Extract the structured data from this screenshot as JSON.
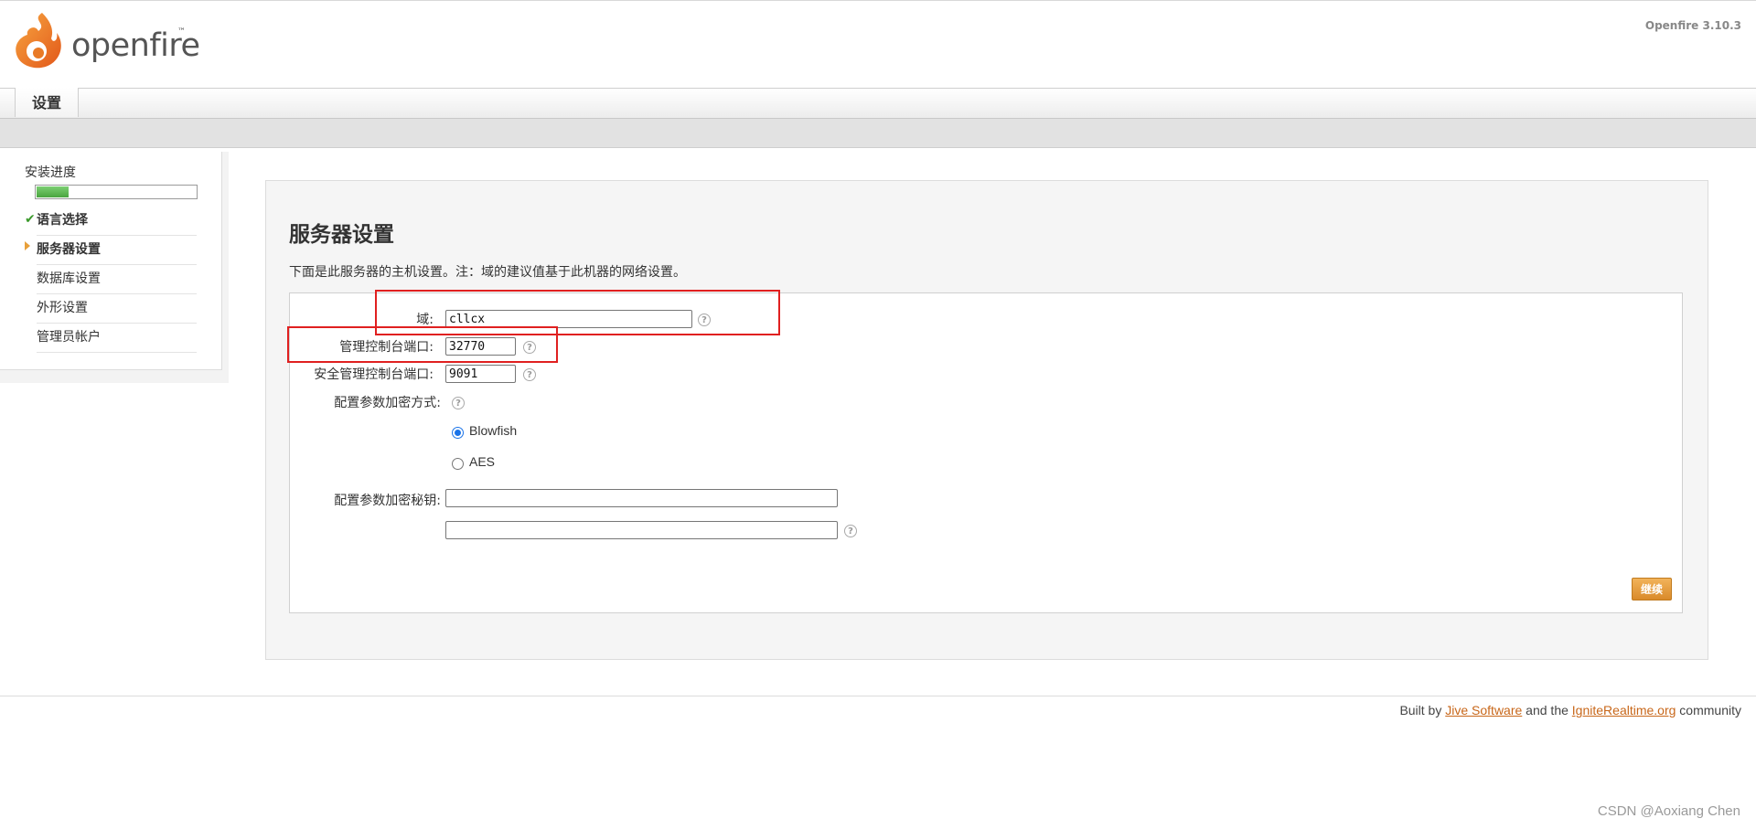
{
  "header": {
    "logo_text": "openfire",
    "logo_tm": "™",
    "version": "Openfire 3.10.3"
  },
  "tabs": [
    {
      "label": "设置",
      "active": true
    }
  ],
  "sidebar": {
    "progress_label": "安装进度",
    "progress": 0.2,
    "items": [
      {
        "label": "语言选择",
        "state": "done"
      },
      {
        "label": "服务器设置",
        "state": "current"
      },
      {
        "label": "数据库设置",
        "state": "pending"
      },
      {
        "label": "外形设置",
        "state": "pending"
      },
      {
        "label": "管理员帐户",
        "state": "pending"
      }
    ]
  },
  "main": {
    "title": "服务器设置",
    "description": "下面是此服务器的主机设置。注：域的建议值基于此机器的网络设置。",
    "fields": {
      "domain": {
        "label": "域:",
        "value": "cllcx"
      },
      "admin_port": {
        "label": "管理控制台端口:",
        "value": "32770"
      },
      "secure_admin_port": {
        "label": "安全管理控制台端口:",
        "value": "9091"
      },
      "encryption": {
        "label": "配置参数加密方式:",
        "options": [
          {
            "label": "Blowfish",
            "selected": true
          },
          {
            "label": "AES",
            "selected": false
          }
        ]
      },
      "encryption_key": {
        "label": "配置参数加密秘钥:",
        "value": "",
        "confirm_value": ""
      }
    },
    "help_glyph": "?",
    "continue_label": "继续"
  },
  "footer": {
    "prefix": "Built by ",
    "link1": "Jive Software",
    "middle": " and the ",
    "link2": "IgniteRealtime.org",
    "suffix": " community"
  },
  "watermark": "CSDN @Aoxiang Chen",
  "colors": {
    "accent_orange": "#e8862a",
    "progress_green": "#4aa53f",
    "annotation_red": "#e02020",
    "link": "#c8671a"
  }
}
